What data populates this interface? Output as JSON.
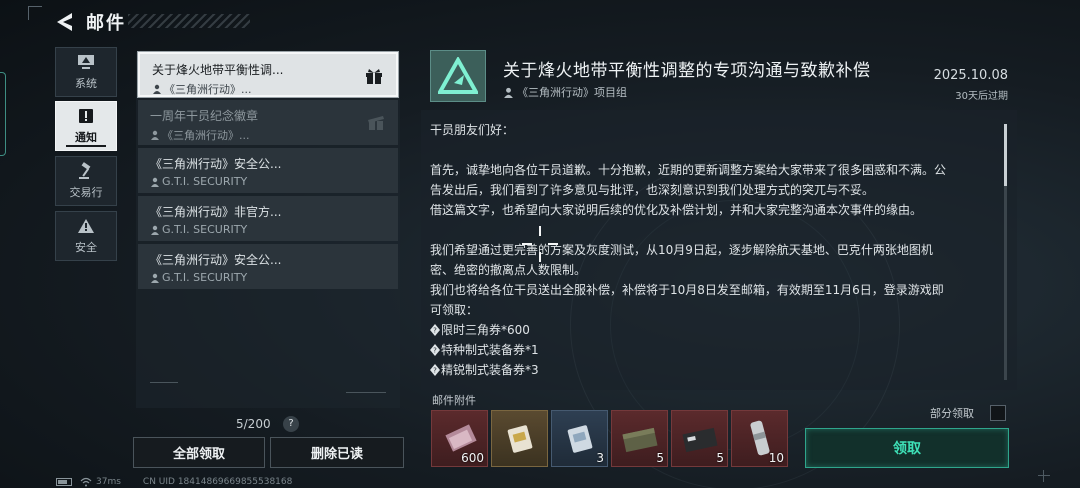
{
  "header": {
    "title": "邮件"
  },
  "categories": [
    {
      "label": "系统",
      "icon": "monitor-icon",
      "active": false
    },
    {
      "label": "通知",
      "icon": "alert-icon",
      "active": true
    },
    {
      "label": "交易行",
      "icon": "gavel-icon",
      "active": false
    },
    {
      "label": "安全",
      "icon": "warning-icon",
      "active": false
    }
  ],
  "mail_list": {
    "items": [
      {
        "title": "关于烽火地带平衡性调...",
        "sender": "《三角洲行动》...",
        "badge": "gift-icon",
        "state": "selected"
      },
      {
        "title": "一周年干员纪念徽章",
        "sender": "《三角洲行动》...",
        "badge": "gift-opened-icon",
        "state": "read"
      },
      {
        "title": "《三角洲行动》安全公...",
        "sender": "G.T.I. SECURITY",
        "state": "unread"
      },
      {
        "title": "《三角洲行动》非官方...",
        "sender": "G.T.I. SECURITY",
        "state": "unread"
      },
      {
        "title": "《三角洲行动》安全公...",
        "sender": "G.T.I. SECURITY",
        "state": "unread"
      }
    ],
    "count": "5/200",
    "help": "?"
  },
  "actions": {
    "claim_all": "全部领取",
    "delete_read": "删除已读"
  },
  "detail": {
    "title": "关于烽火地带平衡性调整的专项沟通与致歉补偿",
    "sender": "《三角洲行动》项目组",
    "date": "2025.10.08",
    "expiry": "30天后过期",
    "body": {
      "greeting": "干员朋友们好：",
      "para1_line1": "首先，诚挚地向各位干员道歉。十分抱歉，近期的更新调整方案给大家带来了很多困惑和不满。公",
      "para1_line2": "告发出后，我们看到了许多意见与批评，也深刻意识到我们处理方式的突兀与不妥。",
      "para1_line3": "借这篇文字，也希望向大家说明后续的优化及补偿计划，并和大家完整沟通本次事件的缘由。",
      "para2_line1": "我们希望通过更完善的方案及灰度测试，从10月9日起，逐步解除航天基地、巴克什两张地图机",
      "para2_line2": "密、绝密的撤离点人数限制。",
      "para3_line1": "我们也将给各位干员送出全服补偿，补偿将于10月8日发至邮箱，有效期至11月6日，登录游戏即",
      "para3_line2": "可领取：",
      "reward1": "限时三角券*600",
      "reward2": "特种制式装备券*1",
      "reward3": "精锐制式装备券*3"
    }
  },
  "attachments": {
    "label": "邮件附件",
    "partial_claim_label": "部分领取",
    "claim_button": "领取",
    "items": [
      {
        "name": "triangle-coupon-icon",
        "quantity": "600",
        "rarity": "red"
      },
      {
        "name": "special-equipment-coupon-icon",
        "quantity": "",
        "rarity": "gold"
      },
      {
        "name": "elite-equipment-coupon-icon",
        "quantity": "3",
        "rarity": "blue"
      },
      {
        "name": "ammo-crate-icon",
        "quantity": "5",
        "rarity": "red"
      },
      {
        "name": "supply-case-icon",
        "quantity": "5",
        "rarity": "red"
      },
      {
        "name": "bandage-icon",
        "quantity": "10",
        "rarity": "red"
      }
    ]
  },
  "status": {
    "ping": "37ms",
    "uid": "CN UID 18414869669855538168"
  },
  "colors": {
    "accent": "#3ee0b7",
    "rarity_red": "#5b2a2c",
    "rarity_gold": "#5a4a30",
    "rarity_blue": "#2e3f52"
  }
}
